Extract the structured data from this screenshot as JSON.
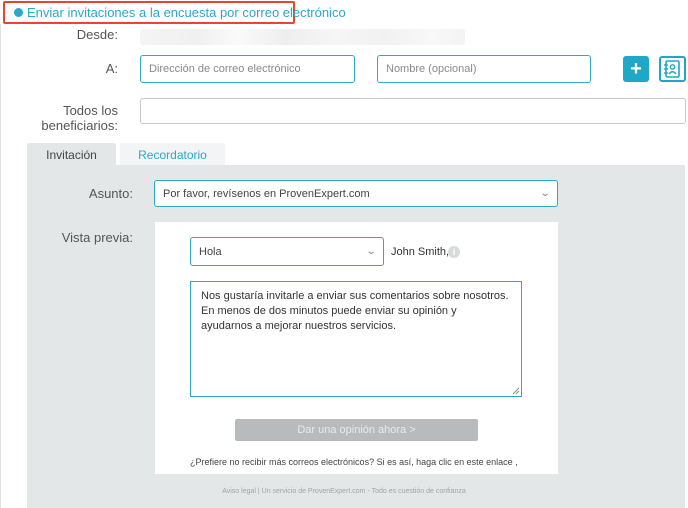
{
  "header": {
    "title": "Enviar invitaciones a la encuesta por correo electrónico"
  },
  "form": {
    "from_label": "Desde:",
    "to_label": "A:",
    "email_placeholder": "Dirección de correo electrónico",
    "name_placeholder": "Nombre (opcional)",
    "add_button_label": "+",
    "all_recipients_label_line1": "Todos los",
    "all_recipients_label_line2": "beneficiarios:"
  },
  "tabs": [
    {
      "label": "Invitación",
      "active": true
    },
    {
      "label": "Recordatorio",
      "active": false
    }
  ],
  "subject": {
    "label": "Asunto:",
    "value": "Por favor, revísenos en ProvenExpert.com"
  },
  "preview": {
    "label": "Vista previa:",
    "greeting_value": "Hola",
    "recipient_name": "John Smith,",
    "message": "Nos gustaría invitarle a enviar sus comentarios sobre nosotros. En menos de dos minutos puede enviar su opinión y ayudarnos a mejorar nuestros servicios.",
    "cta_label": "Dar una opinión ahora >",
    "unsubscribe_text": "¿Prefiere no recibir más correos electrónicos? Si es así, haga clic en este enlace ,"
  },
  "footer": {
    "text": "Aviso legal | Un servicio de ProvenExpert.com - Todo es cuestión de confianza"
  },
  "colors": {
    "accent": "#1fa7c7",
    "highlight_border": "#e8472f",
    "panel_bg": "#e4e7e8",
    "disabled_button": "#b8bbbd"
  },
  "icons": {
    "header_bullet": "circle-bullet-icon",
    "add": "plus-icon",
    "address_book": "address-book-icon",
    "info": "info-icon",
    "dropdown": "chevron-down-icon"
  }
}
